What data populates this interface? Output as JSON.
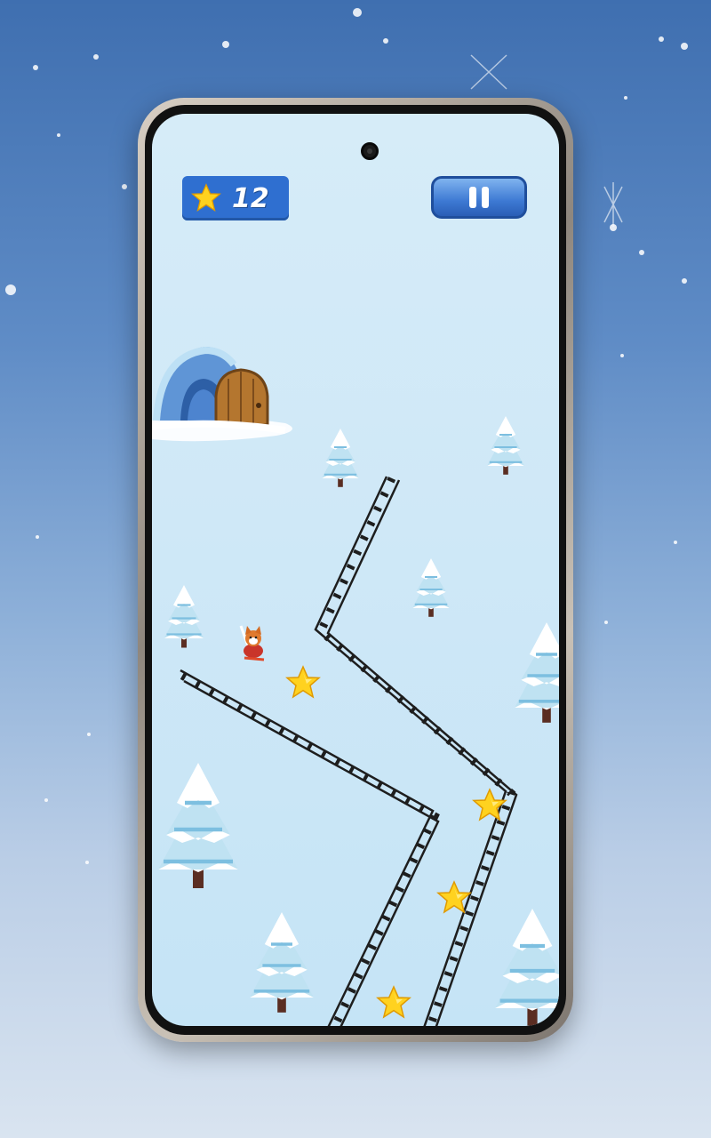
{
  "hud": {
    "score_icon": "star-icon",
    "score_value": "12",
    "pause_icon": "pause-icon"
  },
  "colors": {
    "hud_blue": "#2f6fd0",
    "star_yellow": "#ffd21f",
    "fence_dark": "#1e1e1e",
    "door_wood": "#b4762f"
  }
}
